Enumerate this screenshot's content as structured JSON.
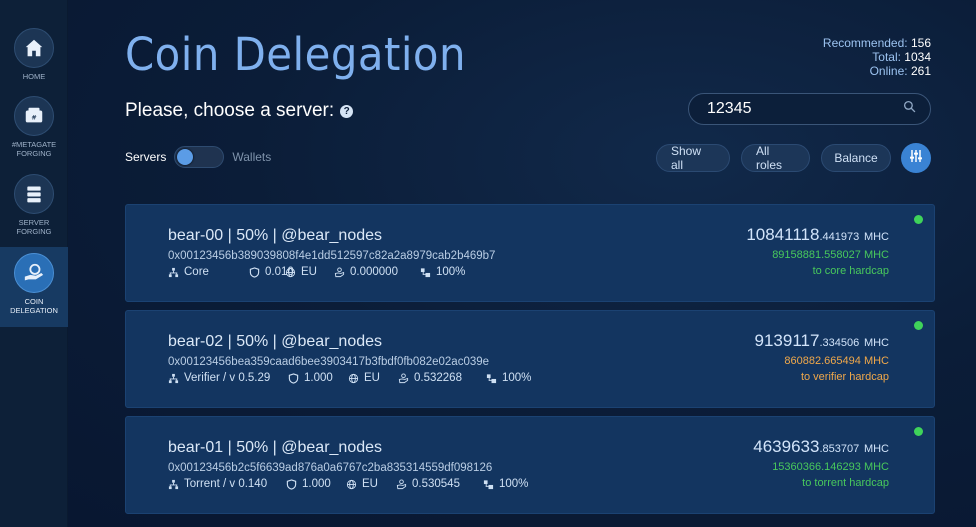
{
  "colors": {
    "accent": "#2a6fb6",
    "online": "#3fd35a",
    "green": "#48c85c",
    "orange": "#f0a84a"
  },
  "sidebar": {
    "items": [
      {
        "label": "HOME",
        "icon": "home-icon"
      },
      {
        "label": "#METAGATE FORGING",
        "icon": "wallet-icon"
      },
      {
        "label": "SERVER FORGING",
        "icon": "server-icon"
      },
      {
        "label": "COIN DELEGATION",
        "icon": "hand-coin-icon",
        "active": true
      }
    ]
  },
  "header": {
    "title": "Coin Delegation",
    "subtitle": "Please, choose a server:",
    "stats": [
      {
        "label": "Recommended:",
        "value": "156"
      },
      {
        "label": "Total:",
        "value": "1034"
      },
      {
        "label": "Online:",
        "value": "261"
      }
    ]
  },
  "search": {
    "value": "12345"
  },
  "toggle": {
    "left_label": "Servers",
    "right_label": "Wallets",
    "state": "Servers"
  },
  "filters": {
    "show_all": "Show all",
    "all_roles": "All roles",
    "balance": "Balance"
  },
  "servers": [
    {
      "name": "bear-00 | 50% | @bear_nodes",
      "address": "0x00123456b389039808f4e1dd512597c82a2a8979cab2b469b7",
      "role": "Core",
      "fee": "0.010",
      "region": "EU",
      "reward": "0.000000",
      "uptime": "100%",
      "amount_int": "10841118",
      "amount_dec": ".441973",
      "unit": "MHC",
      "sub_amount": "89158881.558027 MHC",
      "sub_color": "green",
      "hardcap": "to core hardcap",
      "online": true
    },
    {
      "name": "bear-02 | 50% | @bear_nodes",
      "address": "0x00123456bea359caad6bee3903417b3fbdf0fb082e02ac039e",
      "role": "Verifier / v 0.5.29",
      "fee": "1.000",
      "region": "EU",
      "reward": "0.532268",
      "uptime": "100%",
      "amount_int": "9139117",
      "amount_dec": ".334506",
      "unit": "MHC",
      "sub_amount": "860882.665494 MHC",
      "sub_color": "orange",
      "hardcap": "to verifier hardcap",
      "online": true
    },
    {
      "name": "bear-01 | 50% | @bear_nodes",
      "address": "0x00123456b2c5f6639ad876a0a6767c2ba835314559df098126",
      "role": "Torrent / v 0.140",
      "fee": "1.000",
      "region": "EU",
      "reward": "0.530545",
      "uptime": "100%",
      "amount_int": "4639633",
      "amount_dec": ".853707",
      "unit": "MHC",
      "sub_amount": "15360366.146293 MHC",
      "sub_color": "green",
      "hardcap": "to torrent hardcap",
      "online": true
    }
  ]
}
